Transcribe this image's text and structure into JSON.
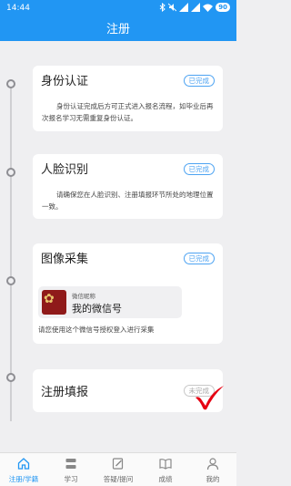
{
  "status_bar": {
    "time": "14:44",
    "battery": "90",
    "icons": [
      "bluetooth-icon",
      "mute-icon",
      "signal-icon",
      "signal-icon",
      "wifi-icon",
      "battery-icon"
    ]
  },
  "header": {
    "title": "注册"
  },
  "steps": [
    {
      "title": "身份认证",
      "status": "已完成",
      "desc": "身份认证完成后方可正式进入报名流程，如毕业后再次报名学习无需重复身份认证。"
    },
    {
      "title": "人脸识别",
      "status": "已完成",
      "desc": "请确保您在人脸识别、注册填报环节所处的地理位置一致。"
    },
    {
      "title": "图像采集",
      "status": "已完成",
      "wechat": {
        "caption": "微信昵称",
        "name": "我的微信号"
      },
      "desc": "请您使用这个微信号授权登入进行采集"
    },
    {
      "title": "注册填报",
      "status": "未完成"
    }
  ],
  "tabs": [
    {
      "label": "注册/学籍",
      "icon": "home-icon",
      "active": true
    },
    {
      "label": "学习",
      "icon": "layers-icon",
      "active": false
    },
    {
      "label": "答疑/提问",
      "icon": "edit-icon",
      "active": false
    },
    {
      "label": "成绩",
      "icon": "book-icon",
      "active": false
    },
    {
      "label": "我的",
      "icon": "user-icon",
      "active": false
    }
  ],
  "colors": {
    "primary": "#2196f3",
    "done_badge": "#4da3f2",
    "pending_badge": "#aaaaaa",
    "check_mark": "#e60012"
  }
}
